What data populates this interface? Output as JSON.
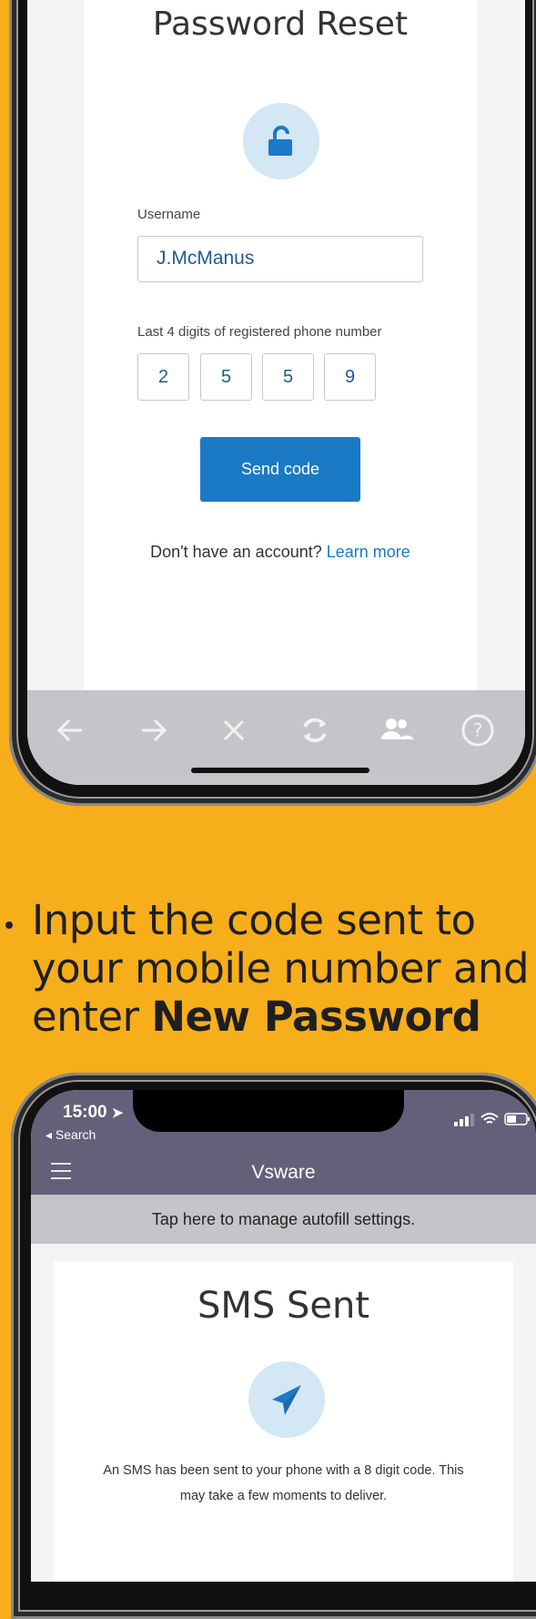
{
  "reset_screen": {
    "title": "Password Reset",
    "username_label": "Username",
    "username_value": "J.McManus",
    "phone_label": "Last 4 digits of registered phone number",
    "digits": [
      "2",
      "5",
      "5",
      "9"
    ],
    "send_button": "Send code",
    "no_account_text": "Don't have an account?",
    "learn_more": "Learn more",
    "toolbar_icons": [
      "back-arrow-icon",
      "forward-arrow-icon",
      "close-icon",
      "refresh-icon",
      "people-icon",
      "help-icon"
    ]
  },
  "instruction": {
    "line1": "Input the code sent to your mobile number and enter",
    "bold": "New Password"
  },
  "sms_screen": {
    "time": "15:00",
    "back_label": "◂ Search",
    "nav_title": "Vsware",
    "autofill_banner": "Tap here to manage autofill settings.",
    "title": "SMS Sent",
    "message_line1": "An SMS has been sent to your phone with a 8 digit code. This",
    "message_line2": "may take a few moments to deliver."
  },
  "colors": {
    "background": "#f7ae1b",
    "accent_blue": "#1b7ac6",
    "nav_purple": "#64607a"
  }
}
